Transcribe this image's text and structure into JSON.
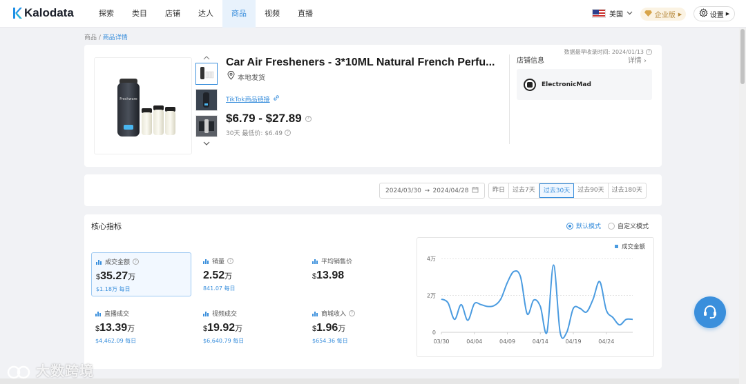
{
  "app": {
    "name": "Kalodata"
  },
  "nav": {
    "items": [
      "探索",
      "类目",
      "店铺",
      "达人",
      "商品",
      "视频",
      "直播"
    ],
    "active_index": 4
  },
  "header": {
    "region": "美国",
    "enterprise": "企业版",
    "settings": "设置"
  },
  "breadcrumb": {
    "parent": "商品",
    "sep": " / ",
    "current": "商品详情"
  },
  "product": {
    "update_time": "数据最早收录时间: 2024/01/13",
    "title": "Car Air Fresheners - 3*10ML Natural French Perfu...",
    "shipping": "本地发货",
    "link_text": "TikTok商品链接",
    "price_range": "$6.79 - $27.89",
    "lowest_price": "30天 最低价: $6.49"
  },
  "shop": {
    "label": "店铺信息",
    "more": "详情",
    "name": "ElectronicMad"
  },
  "date_filter": {
    "start": "2024/03/30",
    "arrow": "→",
    "end": "2024/04/28",
    "presets": [
      "昨日",
      "过去7天",
      "过去30天",
      "过去90天",
      "过去180天"
    ],
    "active_preset": 2
  },
  "metrics": {
    "title": "核心指标",
    "mode_default": "默认模式",
    "mode_custom": "自定义模式",
    "cards": [
      {
        "label": "成交金额",
        "currency": "$",
        "value": "35.27",
        "unit": "万",
        "daily": "$1.18万 每日",
        "active": true
      },
      {
        "label": "销量",
        "currency": "",
        "value": "2.52",
        "unit": "万",
        "daily": "841.07 每日"
      },
      {
        "label": "平均销售价",
        "currency": "$",
        "value": "13.98",
        "unit": "",
        "daily": ""
      },
      {
        "label": "直播成交",
        "currency": "$",
        "value": "13.39",
        "unit": "万",
        "daily": "$4,462.09 每日"
      },
      {
        "label": "视频成交",
        "currency": "$",
        "value": "19.92",
        "unit": "万",
        "daily": "$6,640.79 每日"
      },
      {
        "label": "商城收入",
        "currency": "$",
        "value": "1.96",
        "unit": "万",
        "daily": "$654.36 每日"
      }
    ]
  },
  "chart_data": {
    "type": "line",
    "legend": "成交金额",
    "legend_position": "top-right",
    "y_ticks": [
      "0",
      "2万",
      "4万"
    ],
    "ylim": [
      0,
      40000
    ],
    "x_ticks": [
      "03/30",
      "04/04",
      "04/09",
      "04/14",
      "04/19",
      "04/24"
    ],
    "x": [
      "03/30",
      "03/31",
      "04/01",
      "04/02",
      "04/03",
      "04/04",
      "04/05",
      "04/06",
      "04/07",
      "04/08",
      "04/09",
      "04/10",
      "04/11",
      "04/12",
      "04/13",
      "04/14",
      "04/15",
      "04/16",
      "04/17",
      "04/18",
      "04/19",
      "04/20",
      "04/21",
      "04/22",
      "04/23",
      "04/24",
      "04/25",
      "04/26",
      "04/27",
      "04/28"
    ],
    "series": [
      {
        "name": "成交金额",
        "color": "#4a9be0",
        "values": [
          18000,
          16000,
          7000,
          15000,
          6500,
          15500,
          15000,
          14000,
          14500,
          18000,
          27000,
          33000,
          30000,
          10000,
          17500,
          14000,
          0,
          36500,
          0,
          0,
          13000,
          13000,
          11000,
          18000,
          27500,
          12000,
          8000,
          4000,
          7000,
          7000
        ]
      }
    ],
    "colors": {
      "line": "#4a9be0",
      "grid": "#e3e3e3",
      "axis": "#cfcfcf"
    }
  },
  "watermark": "大数跨境"
}
